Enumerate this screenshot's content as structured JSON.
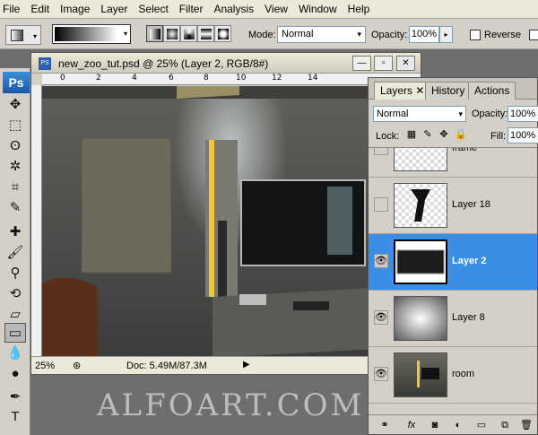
{
  "menu": [
    "File",
    "Edit",
    "Image",
    "Layer",
    "Select",
    "Filter",
    "Analysis",
    "View",
    "Window",
    "Help"
  ],
  "options": {
    "mode_label": "Mode:",
    "mode_value": "Normal",
    "opacity_label": "Opacity:",
    "opacity_value": "100%",
    "reverse_label": "Reverse"
  },
  "tools": {
    "logo": "Ps",
    "items": [
      "move-icon",
      "marquee-icon",
      "lasso-icon",
      "magic-wand-icon",
      "crop-icon",
      "eyedropper-icon",
      "healing-brush-icon",
      "brush-icon",
      "clone-stamp-icon",
      "history-brush-icon",
      "eraser-icon",
      "gradient-icon",
      "blur-icon",
      "dodge-icon",
      "pen-icon",
      "type-icon"
    ],
    "selected": "gradient-icon"
  },
  "document": {
    "title": "new_zoo_tut.psd @ 25% (Layer 2, RGB/8#)",
    "ruler_labels": [
      "0",
      "2",
      "4",
      "6",
      "8",
      "10",
      "12",
      "14"
    ],
    "zoom": "25%",
    "doc_info": "Doc: 5.49M/87.3M"
  },
  "layers_panel": {
    "tabs": [
      "Layers",
      "History",
      "Actions"
    ],
    "active_tab": "Layers",
    "blend_mode": "Normal",
    "opacity_label": "Opacity:",
    "opacity": "100%",
    "lock_label": "Lock:",
    "fill_label": "Fill:",
    "fill": "100%",
    "layers": [
      {
        "name": "frame",
        "visible": false,
        "selected": false,
        "thumb": "frame"
      },
      {
        "name": "Layer 18",
        "visible": false,
        "selected": false,
        "thumb": "shape"
      },
      {
        "name": "Layer 2",
        "visible": true,
        "selected": true,
        "thumb": "tv"
      },
      {
        "name": "Layer 8",
        "visible": true,
        "selected": false,
        "thumb": "radial"
      },
      {
        "name": "room",
        "visible": true,
        "selected": false,
        "thumb": "room"
      }
    ],
    "footer_icons": [
      "link-icon",
      "fx-icon",
      "mask-icon",
      "adjustment-icon",
      "group-icon",
      "new-layer-icon",
      "trash-icon"
    ]
  },
  "watermark": "ALFOART.COM",
  "colors": {
    "selection": "#3a8ee6",
    "panel": "#d4d0c8",
    "accent_light": "#f2c53a"
  }
}
